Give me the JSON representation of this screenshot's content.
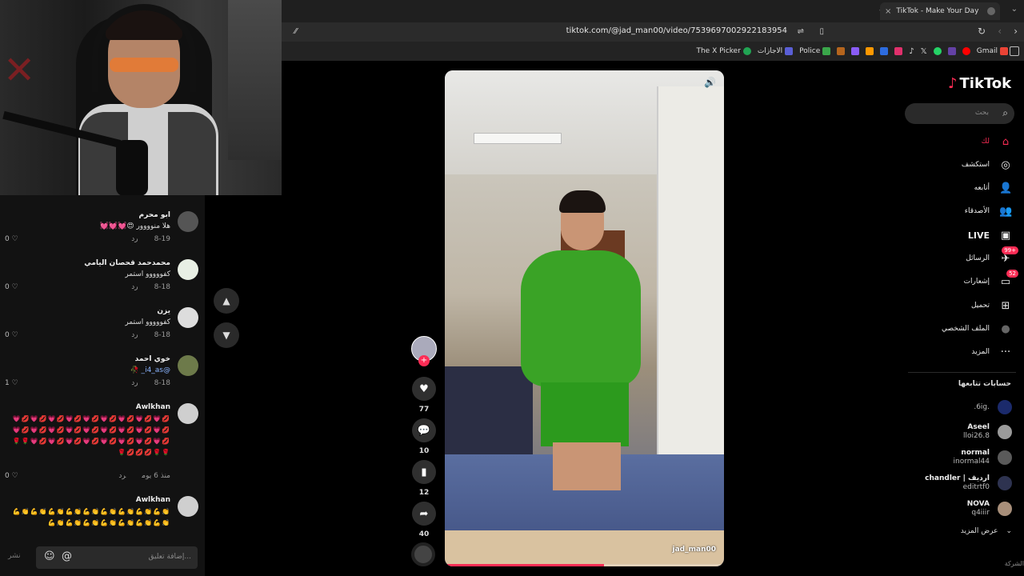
{
  "browser": {
    "tab_title": "TikTok - Make Your Day",
    "new_tab": "+",
    "close_tab": "×",
    "url": "tiktok.com/@jad_man00/video/7539697002922183954",
    "bookmarks": [
      {
        "label": "Gmail",
        "color": "#ea4335"
      },
      {
        "label": "",
        "color": "#ff0000"
      },
      {
        "label": "",
        "color": "#6441a5"
      },
      {
        "label": "",
        "color": "#25d366"
      },
      {
        "label": "",
        "color": "#ffffff"
      },
      {
        "label": "",
        "color": "#000000"
      },
      {
        "label": "",
        "color": "#e1306c"
      },
      {
        "label": "",
        "color": "#2d6cdf"
      },
      {
        "label": "",
        "color": "#ff9900"
      },
      {
        "label": "",
        "color": "#8a5cf6"
      },
      {
        "label": "",
        "color": "#b5651d"
      },
      {
        "label": "Police",
        "color": "#3aa64a"
      },
      {
        "label": "الاجازات",
        "color": "#5a5fd6"
      },
      {
        "label": "The X Picker",
        "color": "#21a453"
      }
    ]
  },
  "comments": [
    {
      "name": "ابو محرم",
      "text": "هلا منوووور 😍💓💓💓",
      "date": "8-19",
      "reply": "رد",
      "likes": "0"
    },
    {
      "name": "محمدحمد قحصان اليامي",
      "text": "كفووووو استمر",
      "date": "8-18",
      "reply": "رد",
      "likes": "0"
    },
    {
      "name": "يزن",
      "text": "كفووووو استمر",
      "date": "8-18",
      "reply": "رد",
      "likes": "0"
    },
    {
      "name": "خوي احمد",
      "text": "@i4_as_ 🥀",
      "date": "8-18",
      "reply": "رد",
      "likes": "1"
    },
    {
      "name": "Awlkhan",
      "text": "💋💗💋💗💋💗💋💗💋💗💋💗💋💗💋💗💋💗💋💗💋💗💋💗💋💗💋💗💋💗💋💗💋💗💋💗💋💗💋💗💋💗💋💗💋💗💋💗💋💗💋💗🌹🌹🌹🌹💋💋💋🌹",
      "date": "منذ 6 يوم",
      "reply": "رد",
      "likes": "0"
    },
    {
      "name": "Awlkhan",
      "text": "👏💪👏💪👏💪👏💪👏💪👏💪👏💪👏💪👏💪👏💪👏💪👏💪👏💪👏💪👏💪👏💪"
    }
  ],
  "comment_input": {
    "placeholder": "إضافة تعليق...",
    "post": "نشر",
    "emoji": "☺",
    "at": "@"
  },
  "video": {
    "author": "jad_man00",
    "progress": 0.57
  },
  "actions": {
    "likes": "77",
    "comments": "10",
    "saves": "12",
    "shares": "40"
  },
  "tiktok": {
    "logo": "TikTok",
    "search_placeholder": "بحث",
    "nav": [
      {
        "label": "لك",
        "icon": "⌂",
        "active": true
      },
      {
        "label": "استكشف",
        "icon": "◎"
      },
      {
        "label": "أتابعه",
        "icon": "👤"
      },
      {
        "label": "الأصدقاء",
        "icon": "👥"
      },
      {
        "label": "LIVE",
        "icon": "▣",
        "live": true
      },
      {
        "label": "الرسائل",
        "icon": "✈",
        "badge": "99+"
      },
      {
        "label": "إشعارات",
        "icon": "▭",
        "badge": "52"
      },
      {
        "label": "تحميل",
        "icon": "⊞"
      },
      {
        "label": "الملف الشخصي",
        "icon": "●"
      },
      {
        "label": "المزيد",
        "icon": "···"
      }
    ],
    "following_title": "حسابات تتابعها",
    "following": [
      {
        "name": "",
        "handle": ".6ig."
      },
      {
        "name": "Aseel",
        "handle": "lloi26.8"
      },
      {
        "name": "normal",
        "handle": "inormal44"
      },
      {
        "name": "chandler | ارديف",
        "handle": "editrtf0"
      },
      {
        "name": "NOVA",
        "handle": "q4iiir"
      }
    ],
    "see_more": "عرض المزيد",
    "company": "الشركة"
  }
}
